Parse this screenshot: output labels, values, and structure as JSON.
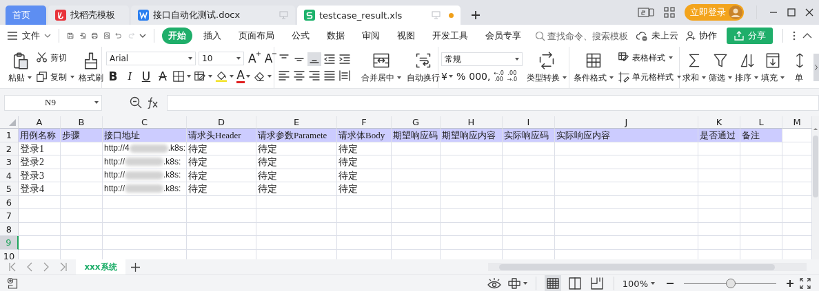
{
  "tabs": [
    {
      "label": "首页",
      "kind": "home",
      "selected": false,
      "unsaved": false
    },
    {
      "label": "找稻壳模板",
      "kind": "docer",
      "selected": false,
      "unsaved": false
    },
    {
      "label": "接口自动化测试.docx",
      "kind": "writer",
      "selected": false,
      "unsaved": false
    },
    {
      "label": "testcase_result.xls",
      "kind": "sheet",
      "selected": true,
      "unsaved": true
    }
  ],
  "account": {
    "login": "立即登录"
  },
  "menu": {
    "file": "文件",
    "quick_access": [
      {
        "disabled": false
      },
      {
        "disabled": false
      },
      {
        "disabled": false
      },
      {
        "disabled": false
      },
      {
        "disabled": false
      },
      {
        "disabled": true
      }
    ],
    "items": [
      {
        "label": "开始",
        "selected": true
      },
      {
        "label": "插入",
        "selected": false
      },
      {
        "label": "页面布局",
        "selected": false
      },
      {
        "label": "公式",
        "selected": false
      },
      {
        "label": "数据",
        "selected": false
      },
      {
        "label": "审阅",
        "selected": false
      },
      {
        "label": "视图",
        "selected": false
      },
      {
        "label": "开发工具",
        "selected": false
      },
      {
        "label": "会员专享",
        "selected": false
      }
    ]
  },
  "search": {
    "placeholder": "查找命令、搜索模板"
  },
  "cloud": "未上云",
  "collaborate": "协作",
  "share": "分享",
  "ribbon": {
    "clipboard": [
      {
        "label": "粘贴",
        "dropdown": true
      },
      {
        "label": "剪切",
        "dropdown": false
      },
      {
        "label": "复制",
        "dropdown": true
      },
      {
        "label": "格式刷",
        "dropdown": false
      }
    ],
    "font": {
      "name": "Arial",
      "size": "10",
      "size_buttons": [
        {
          "label": "A",
          "kind": "grow"
        },
        {
          "label": "A",
          "kind": "shrink"
        }
      ],
      "styles": [
        {
          "label": "B",
          "kind": "bold",
          "dropdown": false
        },
        {
          "label": "I",
          "kind": "italic",
          "dropdown": false
        },
        {
          "label": "U",
          "kind": "underline",
          "dropdown": false
        },
        {
          "label": "A",
          "kind": "strike",
          "dropdown": false
        },
        {
          "kind": "borders",
          "dropdown": true
        },
        {
          "kind": "fill-style",
          "dropdown": true
        },
        {
          "kind": "fill-color",
          "dropdown": true
        },
        {
          "label": "A",
          "kind": "font-color",
          "dropdown": true
        },
        {
          "kind": "clear",
          "dropdown": true
        }
      ]
    },
    "align": [
      {
        "selected": false
      },
      {
        "selected": false
      },
      {
        "selected": true
      },
      {
        "selected": false
      },
      {
        "selected": false
      },
      {
        "selected": false
      },
      {
        "selected": false
      },
      {
        "selected": false
      },
      {
        "selected": false
      },
      {
        "selected": false
      }
    ],
    "align_large": [
      {
        "label": "合并居中",
        "dropdown": true
      },
      {
        "label": "自动换行",
        "dropdown": false
      }
    ],
    "number": {
      "format": "常规",
      "buttons": [
        {
          "kind": "text",
          "label": "¥",
          "dropdown": true
        },
        {
          "kind": "text",
          "label": "%",
          "dropdown": false
        },
        {
          "kind": "text",
          "label": "000,",
          "dropdown": false
        },
        {
          "kind": "decimal",
          "top": "←.0",
          "bottom": ".00"
        },
        {
          "kind": "decimal",
          "top": ".00",
          "bottom": "→.0"
        }
      ]
    },
    "convert": {
      "label": "类型转换",
      "dropdown": true
    },
    "styles": [
      {
        "label": "条件格式",
        "dropdown": true
      },
      {
        "label": "表格样式",
        "dropdown": true
      },
      {
        "label": "单元格样式",
        "dropdown": true
      }
    ],
    "tools": [
      {
        "label": "求和",
        "dropdown": true
      },
      {
        "label": "筛选",
        "dropdown": true
      },
      {
        "label": "排序",
        "dropdown": true
      },
      {
        "label": "填充",
        "dropdown": true
      },
      {
        "label": "单",
        "dropdown": false
      }
    ]
  },
  "formula_bar": {
    "name_box": "N9"
  },
  "sheet": {
    "columns": [
      {
        "label": "A",
        "selected": false
      },
      {
        "label": "B",
        "selected": false
      },
      {
        "label": "C",
        "selected": false
      },
      {
        "label": "D",
        "selected": false
      },
      {
        "label": "E",
        "selected": false
      },
      {
        "label": "F",
        "selected": false
      },
      {
        "label": "G",
        "selected": false
      },
      {
        "label": "H",
        "selected": false
      },
      {
        "label": "I",
        "selected": false
      },
      {
        "label": "J",
        "selected": false
      },
      {
        "label": "K",
        "selected": false
      },
      {
        "label": "L",
        "selected": false
      },
      {
        "label": "M",
        "selected": false
      }
    ],
    "header_row": {
      "number": "1",
      "selected": false,
      "cells": [
        "用例名称",
        "步骤",
        "接口地址",
        "请求头Header",
        "请求参数Paramete",
        "请求体Body",
        "期望响应码",
        "期望响应内容",
        "实际响应码",
        "实际响应内容",
        "是否通过",
        "备注",
        null
      ]
    },
    "rows": [
      {
        "number": "2",
        "selected": false,
        "cells": [
          "登录1",
          null,
          {
            "text": "http://4",
            "redacted": true,
            "tail": ".k8s:"
          },
          "待定",
          "待定",
          "待定",
          null,
          null,
          null,
          null,
          null,
          null,
          null
        ]
      },
      {
        "number": "3",
        "selected": false,
        "cells": [
          "登录2",
          null,
          {
            "text": "http://",
            "redacted": true,
            "tail": ".k8s:"
          },
          "待定",
          "待定",
          "待定",
          null,
          null,
          null,
          null,
          null,
          null,
          null
        ]
      },
      {
        "number": "4",
        "selected": false,
        "cells": [
          "登录3",
          null,
          {
            "text": "http://",
            "redacted": true,
            "tail": ".k8s:"
          },
          "待定",
          "待定",
          "待定",
          null,
          null,
          null,
          null,
          null,
          null,
          null
        ]
      },
      {
        "number": "5",
        "selected": false,
        "cells": [
          "登录4",
          null,
          {
            "text": "http://",
            "redacted": true,
            "tail": ".k8s:"
          },
          "待定",
          "待定",
          "待定",
          null,
          null,
          null,
          null,
          null,
          null,
          null
        ]
      },
      {
        "number": "6",
        "selected": false
      },
      {
        "number": "7",
        "selected": false
      },
      {
        "number": "8",
        "selected": false
      },
      {
        "number": "9",
        "selected": true
      },
      {
        "number": "10",
        "selected": false
      }
    ]
  },
  "sheet_tabs": [
    {
      "label": "xxx系统",
      "selected": true
    }
  ],
  "status_bar": {
    "views": [
      {
        "selected": true
      },
      {
        "selected": false
      },
      {
        "selected": false
      }
    ],
    "zoom": "100%",
    "level": 0.5
  }
}
